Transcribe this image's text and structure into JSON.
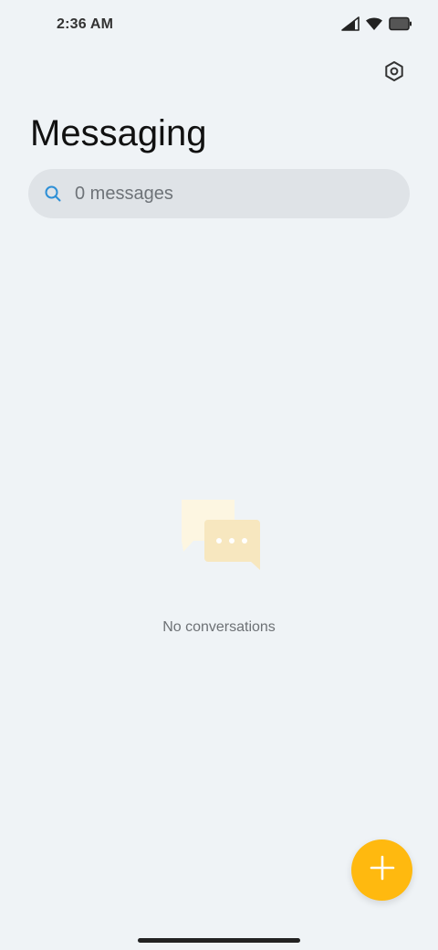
{
  "status_bar": {
    "time": "2:36 AM",
    "icons": [
      "cellular-signal-icon",
      "wifi-icon",
      "battery-icon"
    ]
  },
  "header": {
    "title": "Messaging",
    "settings_icon": "gear-icon"
  },
  "search": {
    "placeholder": "0 messages",
    "icon": "search-icon"
  },
  "empty_state": {
    "illustration": "chat-bubbles-icon",
    "text": "No conversations"
  },
  "fab": {
    "icon": "plus-icon"
  },
  "colors": {
    "background": "#eff3f6",
    "search_background": "#dfe3e7",
    "search_icon": "#2d8fd6",
    "accent": "#ffb90f",
    "bubble_back": "#fdf6e1",
    "bubble_front": "#f7e7bf"
  }
}
